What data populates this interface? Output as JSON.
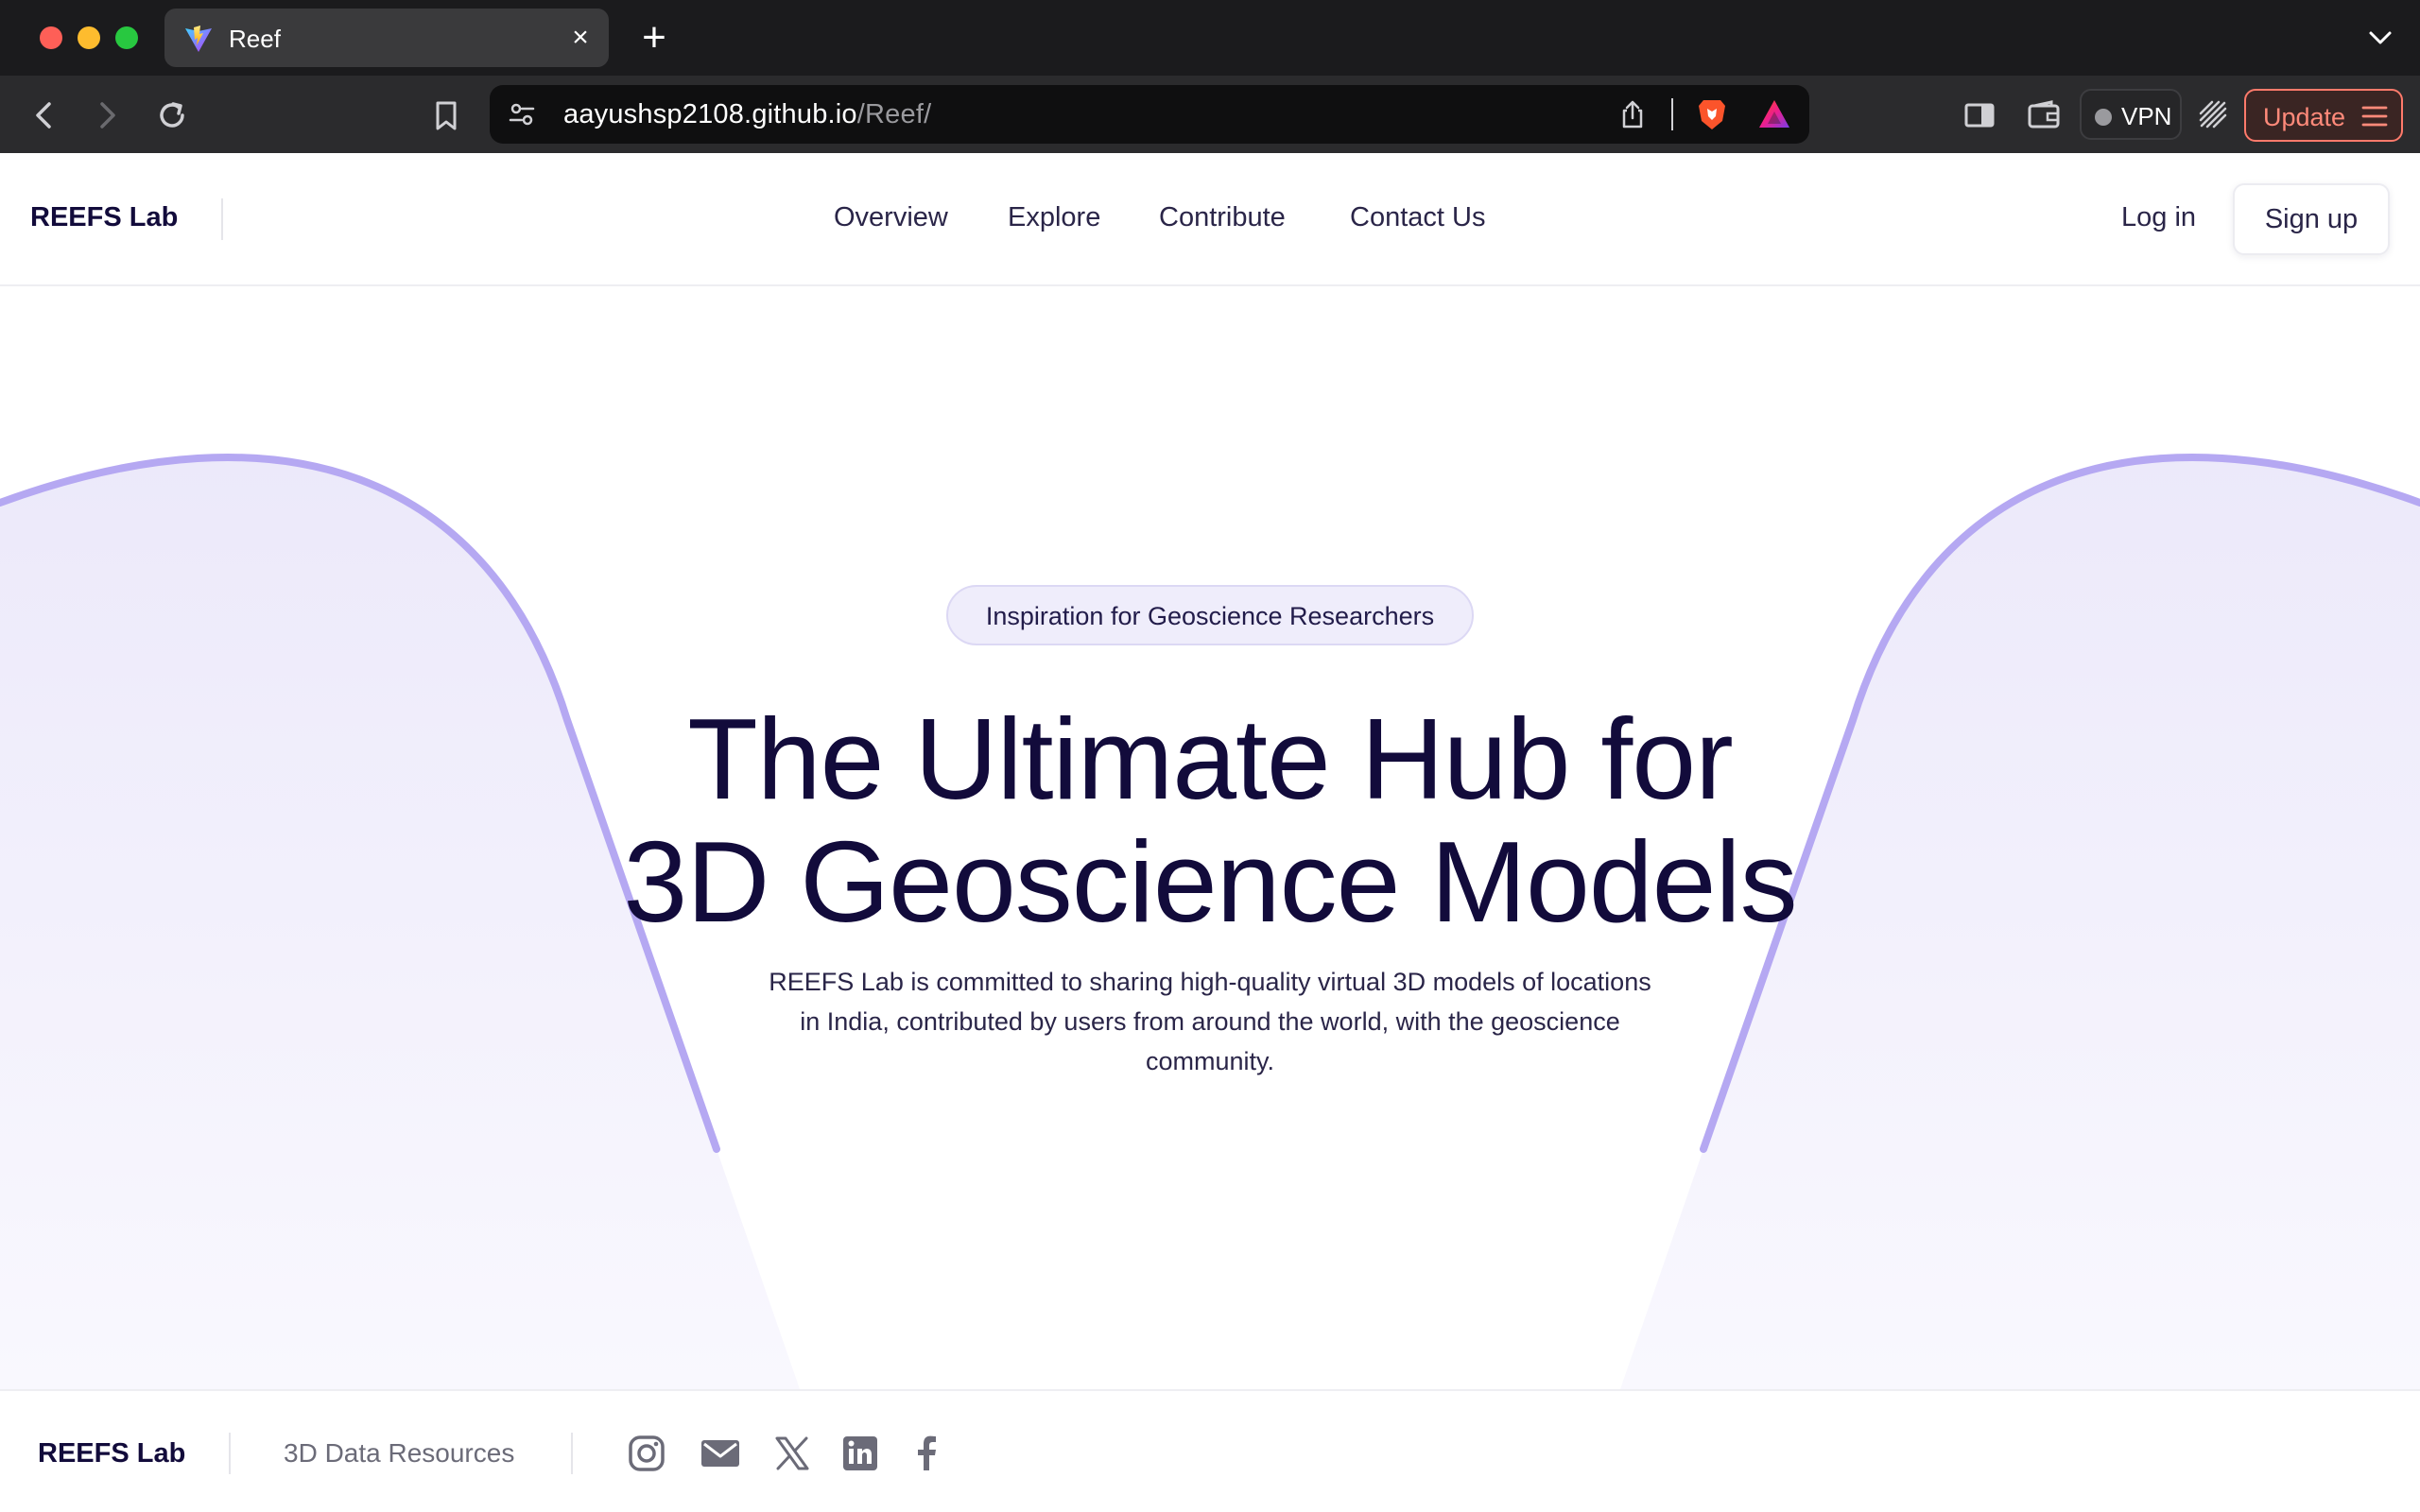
{
  "browser": {
    "tab_title": "Reef",
    "url_host": "aayushsp2108.github.io",
    "url_path": "/Reef/",
    "vpn_label": "VPN",
    "update_label": "Update"
  },
  "header": {
    "brand": "REEFS Lab",
    "nav": [
      "Overview",
      "Explore",
      "Contribute",
      "Contact Us"
    ],
    "login": "Log in",
    "signup": "Sign up"
  },
  "hero": {
    "badge": "Inspiration for Geoscience Researchers",
    "title_line1": "The Ultimate Hub for",
    "title_line2": "3D Geoscience Models",
    "subtitle": "REEFS Lab is committed to sharing high-quality virtual 3D models of locations in India, contributed by users from around the world, with the geoscience community."
  },
  "footer": {
    "brand": "REEFS Lab",
    "link": "3D Data Resources",
    "social_icons": [
      "instagram-icon",
      "mail-icon",
      "x-icon",
      "linkedin-icon",
      "facebook-icon"
    ]
  },
  "colors": {
    "accent": "#a99af0",
    "title": "#120b3b",
    "badge_bg": "#efedfb"
  }
}
